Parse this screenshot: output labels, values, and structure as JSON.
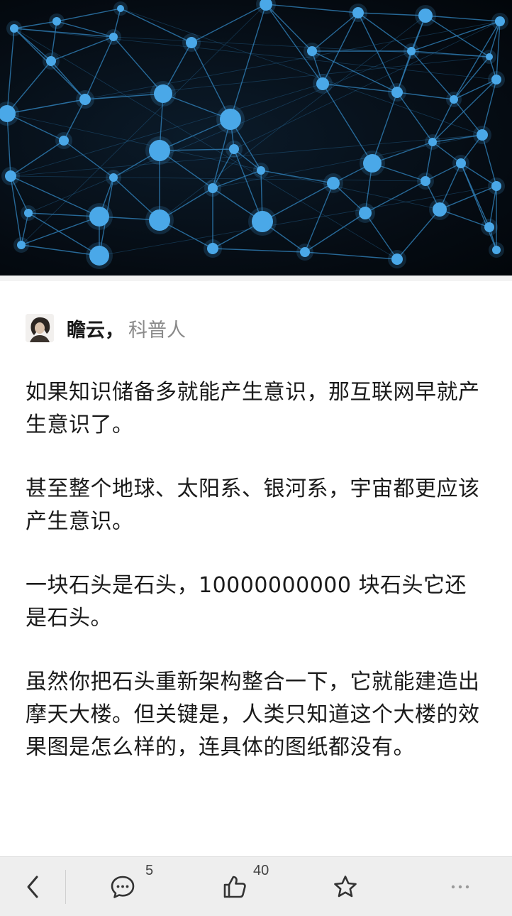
{
  "hero": {
    "image_name": "neural-network-image"
  },
  "author": {
    "name": "瞻云",
    "separator": "，",
    "title": "科普人"
  },
  "answer": {
    "paragraphs": [
      "如果知识储备多就能产生意识，那互联网早就产生意识了。",
      "甚至整个地球、太阳系、银河系，宇宙都更应该产生意识。",
      "一块石头是石头，10000000000 块石头它还是石头。",
      "虽然你把石头重新架构整合一下，它就能建造出摩天大楼。但关键是，人类只知道这个大楼的效果图是怎么样的，连具体的图纸都没有。"
    ]
  },
  "toolbar": {
    "back_icon": "chevron-left-icon",
    "comment_icon": "comment-icon",
    "comment_count": "5",
    "like_icon": "thumbs-up-icon",
    "like_count": "40",
    "favorite_icon": "star-icon",
    "more_icon": "more-icon"
  },
  "colors": {
    "node": "#4aa8e8",
    "link": "#2f7fb8",
    "text": "#1a1a1a",
    "muted": "#8a8a8a",
    "bar_bg": "#eeeeee"
  }
}
